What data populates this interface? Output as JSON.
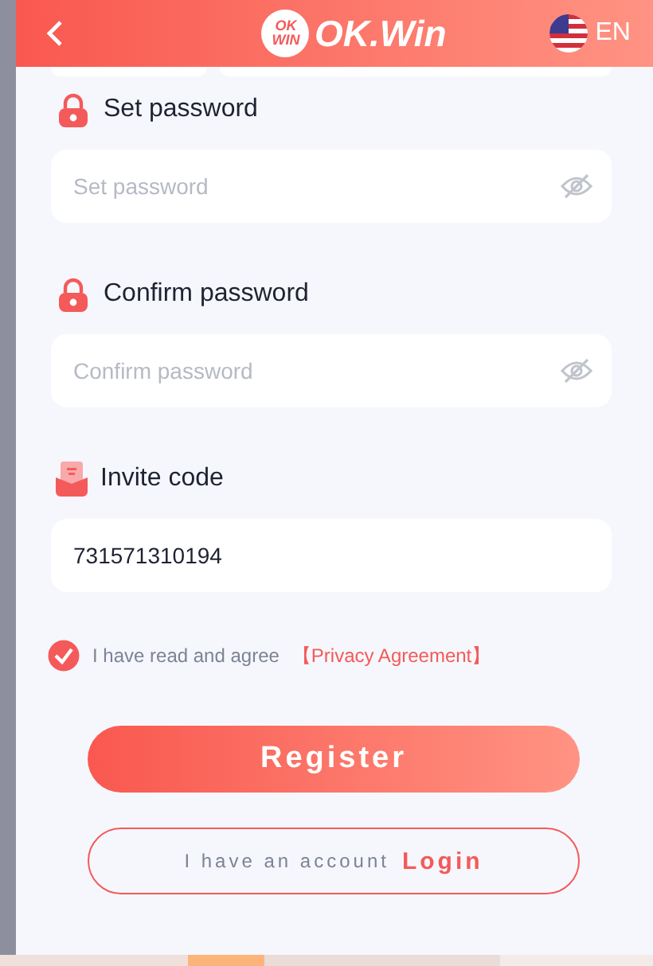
{
  "header": {
    "logo_badge": [
      "OK",
      "WIN"
    ],
    "logo_text": "OK.Win",
    "language": "EN"
  },
  "fields": [
    {
      "kind": "password",
      "label": "Set password",
      "placeholder": "Set password"
    },
    {
      "kind": "password",
      "label": "Confirm password",
      "placeholder": "Confirm password"
    },
    {
      "kind": "invite",
      "label": "Invite code",
      "value": "731571310194"
    }
  ],
  "agreement": {
    "checked": true,
    "text": "I have read and agree",
    "link": "【Privacy Agreement】"
  },
  "register_button": "Register",
  "login": {
    "text": "I have an account",
    "link": "Login"
  }
}
